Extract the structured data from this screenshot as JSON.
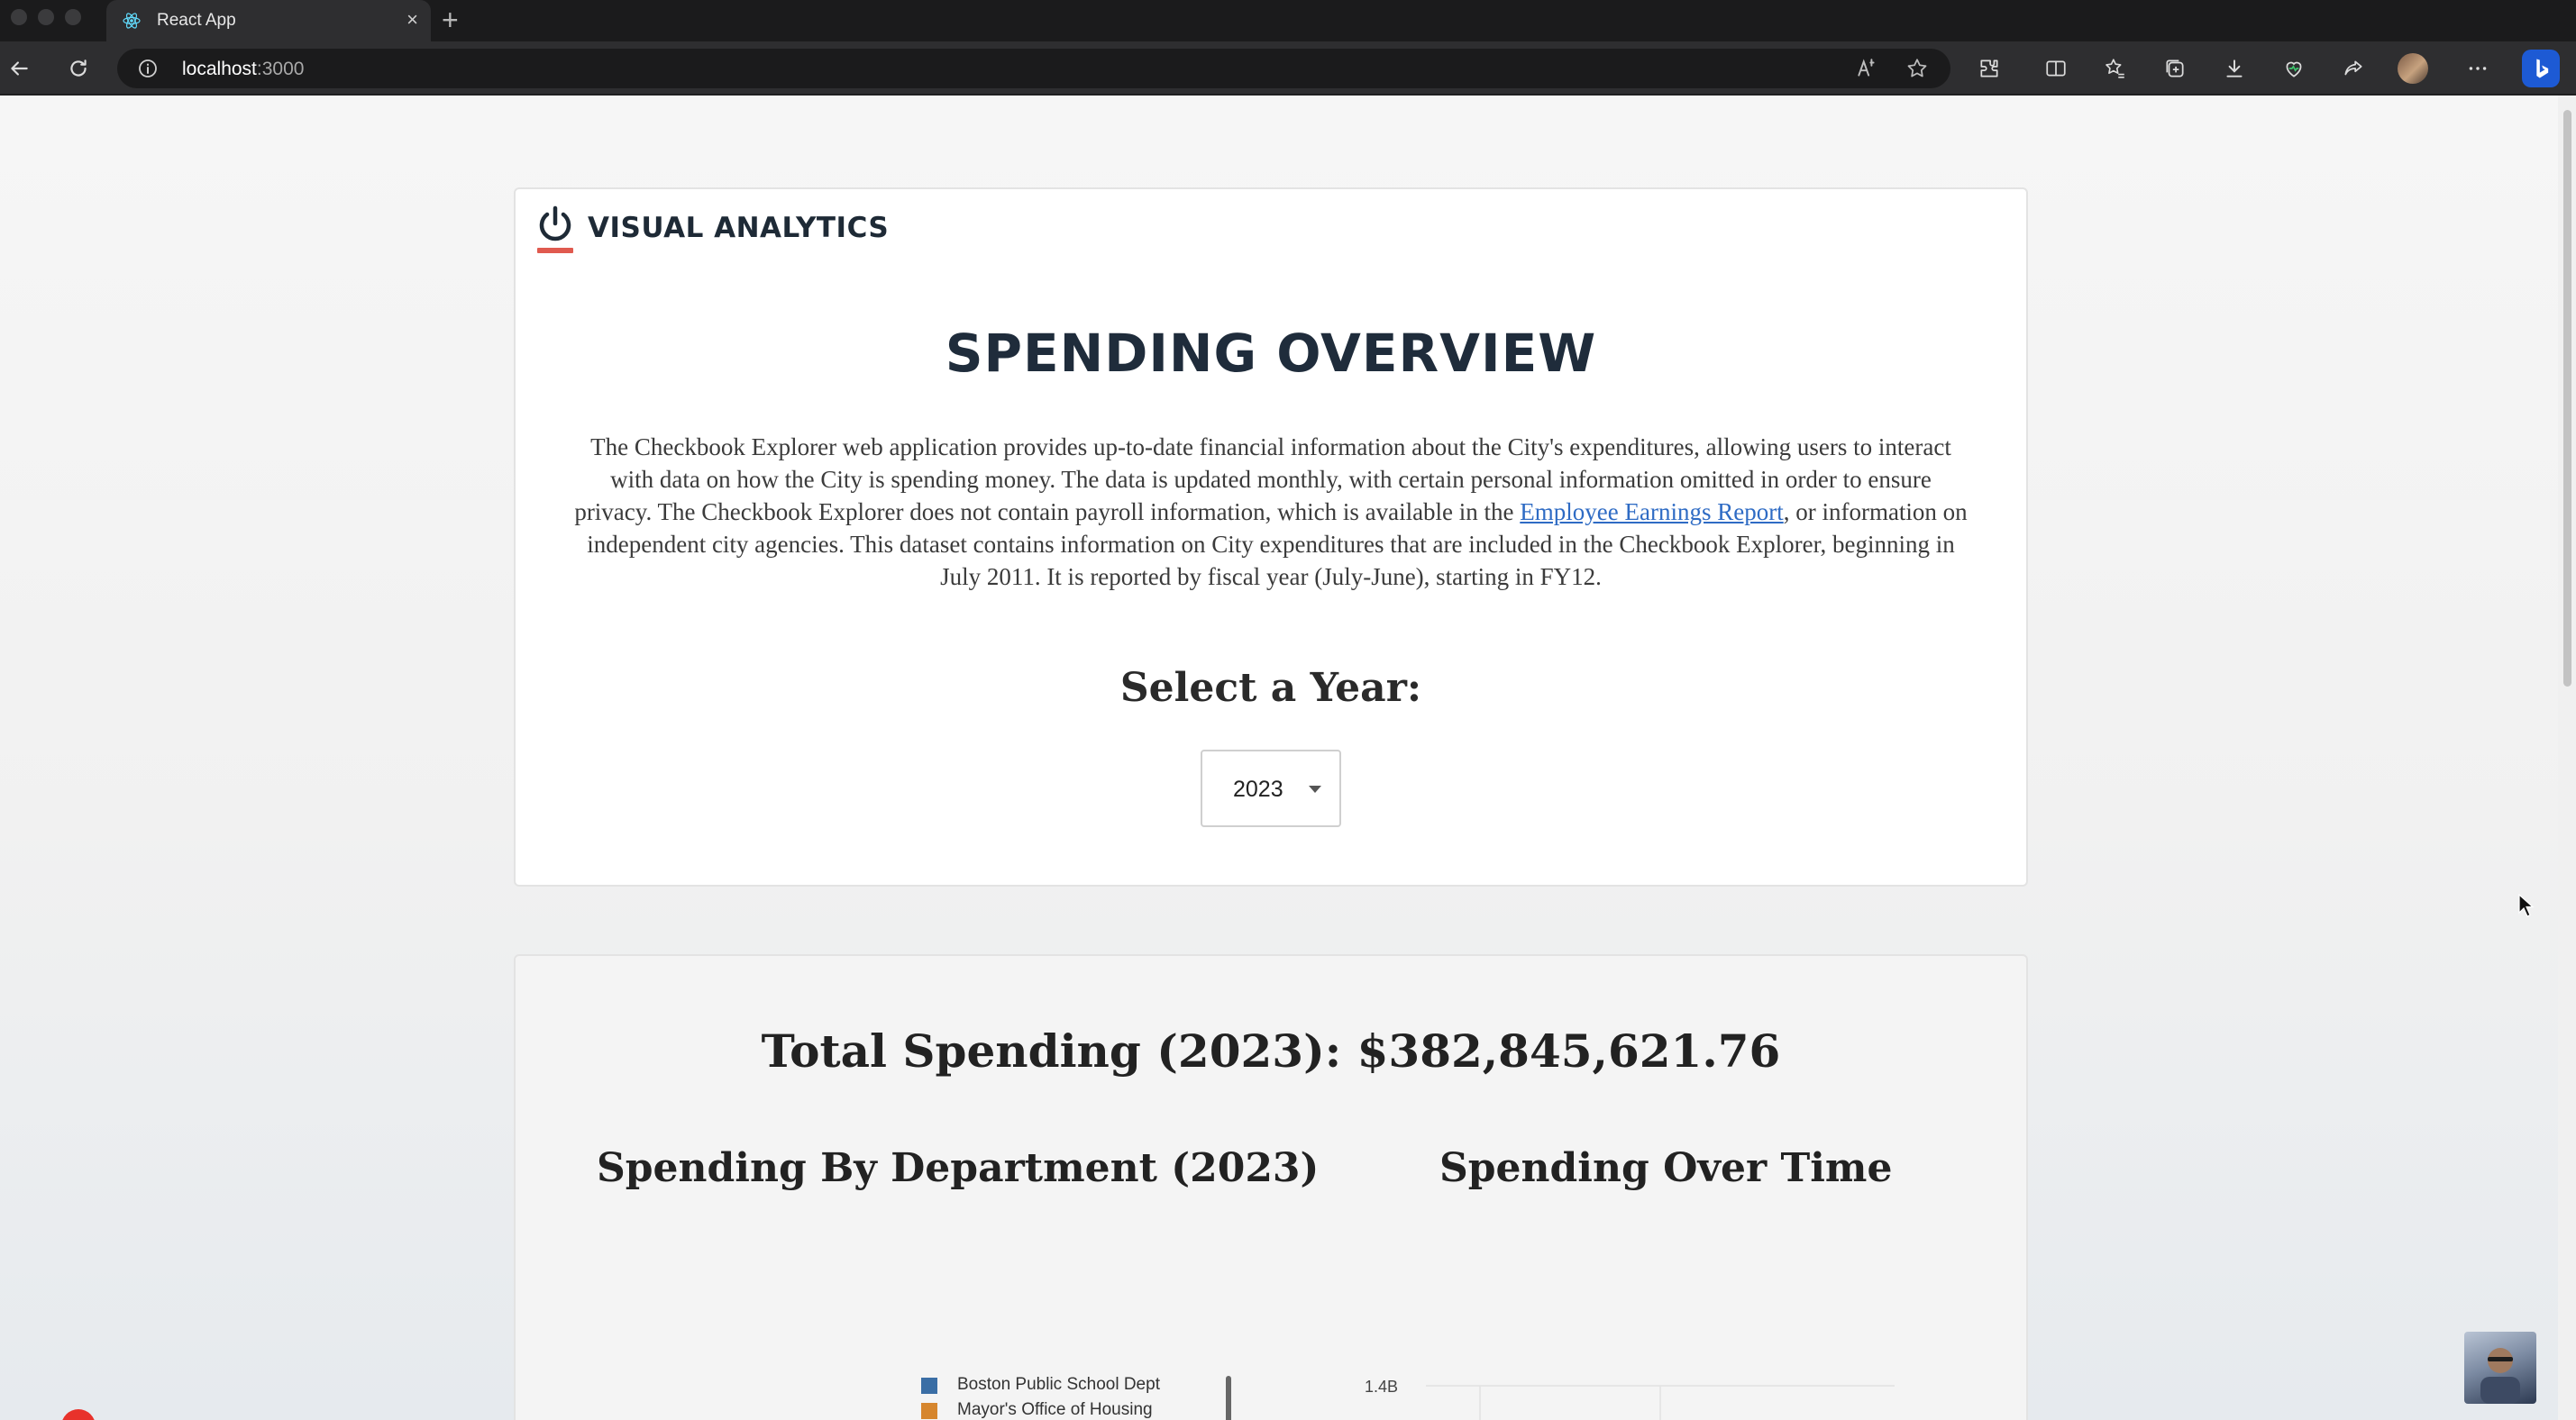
{
  "browser": {
    "tab_title": "React App",
    "tab_close": "×",
    "new_tab": "+",
    "url_host": "localhost",
    "url_port": ":3000"
  },
  "header": {
    "brand": "VISUAL ANALYTICS",
    "accent_color": "#e05a4f"
  },
  "hero": {
    "title": "SPENDING OVERVIEW",
    "description_before_link": "The Checkbook Explorer web application provides up-to-date financial information about the City's expenditures, allowing users to interact with data on how the City is spending money. The data is updated monthly, with certain personal information omitted in order to ensure privacy. The Checkbook Explorer does not contain payroll information, which is available in the ",
    "description_link": "Employee Earnings Report",
    "description_after_link": ", or information on independent city agencies. This dataset contains information on City expenditures that are included in the Checkbook Explorer, beginning in July 2011. It is reported by fiscal year (July-June), starting in FY12.",
    "select_label": "Select a Year:",
    "selected_year": "2023"
  },
  "summary": {
    "total_spending": "Total Spending (2023): $382,845,621.76",
    "dept_chart_title": "Spending By Department (2023)",
    "time_chart_title": "Spending Over Time"
  },
  "chart_data": [
    {
      "type": "pie",
      "title": "Spending By Department (2023)",
      "legend": [
        {
          "name": "Boston Public School Dept",
          "color": "#3a6ea5"
        },
        {
          "name": "Mayor's Office of Housing",
          "color": "#d6862e"
        }
      ],
      "legend_position": "left"
    },
    {
      "type": "line",
      "title": "Spending Over Time",
      "y_tick_labels": [
        "1.4B"
      ],
      "series_color": "#1f1fb8",
      "grid": true
    }
  ]
}
